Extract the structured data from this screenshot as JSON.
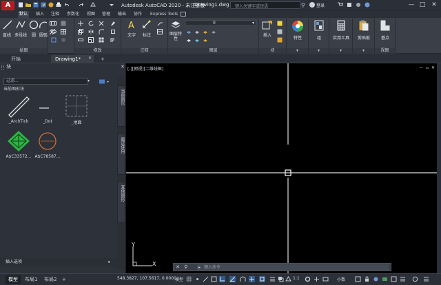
{
  "titlebar": {
    "logo": "A",
    "title": "Autodesk AutoCAD 2020 - 未注册版",
    "file": "Drawing1.dwg",
    "search_placeholder": "键入关键字或短语",
    "user": "登录",
    "minimize": "—",
    "maximize": "□",
    "close": "✕"
  },
  "ribbon_tabs": [
    "默认",
    "插入",
    "注释",
    "参数化",
    "视图",
    "管理",
    "输出",
    "协作",
    "Express Tools"
  ],
  "ribbon": {
    "draw": {
      "label": "绘图",
      "tools": [
        "直线",
        "多段线",
        "圆",
        "圆弧"
      ]
    },
    "modify": {
      "label": "修改"
    },
    "annotation": {
      "label": "注释",
      "tools": [
        "文字",
        "标注"
      ]
    },
    "layers": {
      "label": "图层",
      "tools": [
        "图层特性"
      ],
      "current_layer": "0"
    },
    "block": {
      "label": "块",
      "tools": [
        "插入"
      ]
    },
    "properties": {
      "label": "特性"
    },
    "groups": {
      "label": "组"
    },
    "utilities": {
      "label": "实用工具"
    },
    "clipboard": {
      "label": "剪贴板"
    },
    "view": {
      "label": "视图",
      "tools": [
        "基点"
      ]
    }
  },
  "file_tabs": [
    "开始",
    "Drawing1*",
    "+"
  ],
  "palette": {
    "header": "块",
    "filter_placeholder": "过滤...",
    "section_title": "当前图形块",
    "blocks": [
      {
        "name": "_ArchTick"
      },
      {
        "name": "_Dot"
      },
      {
        "name": "_地面"
      },
      {
        "name": "A$C33572..."
      },
      {
        "name": "A$C78587..."
      }
    ],
    "side_tabs": [
      "当前图形",
      "最近使用",
      "其他图形"
    ],
    "insert_options": "插入选项"
  },
  "canvas": {
    "viewport_label": "[-][俯视][二维线框]",
    "viewport_controls": "— ▫ ✕",
    "ucs_x": "X",
    "ucs_y": "Y",
    "cmd_placeholder": "键入命令",
    "cmd_buttons": "✕ ⚲"
  },
  "statusbar": {
    "layout_tabs": [
      "模型",
      "布局1",
      "布局2"
    ],
    "add_tab": "+",
    "coords": "548.3827, 107.5617, 0.0000",
    "model": "模型",
    "scale": "1:1",
    "units": "小数"
  },
  "colors": {
    "background": "#000000",
    "ribbon": "#3a3f48",
    "accent_block": "#2fb344",
    "accent_block2": "#c8703a"
  }
}
